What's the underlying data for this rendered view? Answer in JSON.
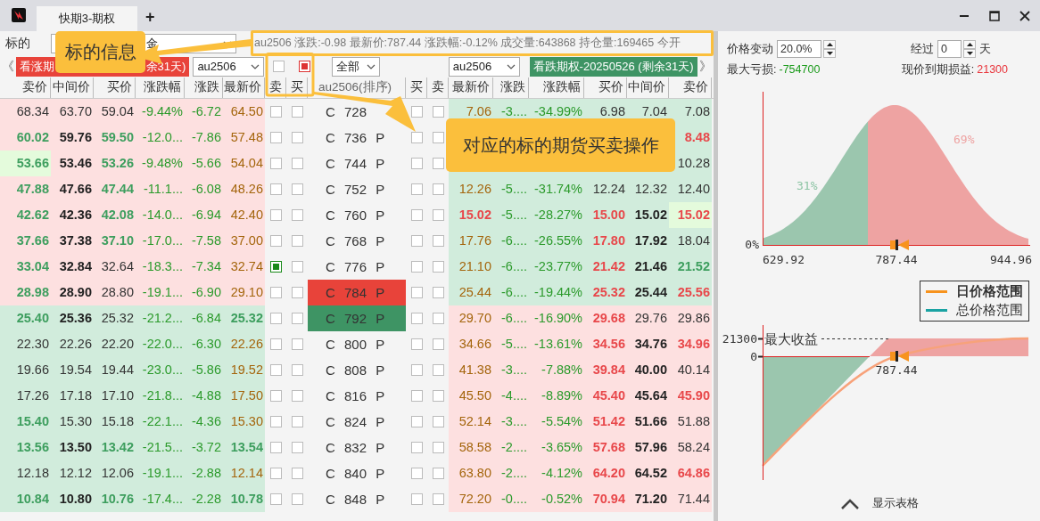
{
  "tab": {
    "label": "快期3-期权",
    "selected": true
  },
  "new_tab": "+",
  "underlying": {
    "label": "标的",
    "value": "金"
  },
  "info": "au2506 涨跌:-0.98 最新价:787.44 涨跌幅:-0.12% 成交量:643868 持仓量:169465 今开",
  "toolbar": {
    "prev": "《",
    "call_banner_parts": [
      "看涨期",
      "余31天)"
    ],
    "call_contract": "au2506",
    "future_checks": [
      {
        "checked": false
      },
      {
        "checked": true
      }
    ],
    "filter": "全部",
    "put_contract": "au2506",
    "put_banner": "看跌期权-20250526 (剩余31天)",
    "next": "》"
  },
  "headers": [
    "卖价",
    "中间价",
    "买价",
    "涨跌幅",
    "涨跌",
    "最新价",
    "卖",
    "买",
    "au2506(排序)",
    "买",
    "卖",
    "最新价",
    "涨跌",
    "涨跌幅",
    "买价",
    "中间价",
    "卖价"
  ],
  "rows": [
    {
      "strike": "C 728",
      "call_itm": true,
      "checks": [
        false,
        false,
        false,
        false
      ],
      "call": {
        "ask": {
          "text": "68.34",
          "kind": "plain"
        },
        "mid": {
          "text": "63.70",
          "kind": "plain"
        },
        "bid": {
          "text": "59.04",
          "kind": "plain"
        },
        "change_pct": {
          "text": "-9.44%",
          "kind": "chg"
        },
        "change": {
          "text": "-6.72",
          "kind": "chg"
        },
        "last": {
          "text": "64.50",
          "kind": "last"
        }
      },
      "put": {
        "last": {
          "text": "7.06",
          "kind": "last"
        },
        "change": {
          "text": "-3....",
          "kind": "chg"
        },
        "change_pct": {
          "text": "-34.99%",
          "kind": "chg"
        },
        "bid": {
          "text": "6.98",
          "kind": "plain"
        },
        "mid": {
          "text": "7.04",
          "kind": "plain"
        },
        "ask": {
          "text": "7.08",
          "kind": "plain"
        }
      }
    },
    {
      "strike": "C 736 P",
      "call_itm": true,
      "checks": [
        false,
        false,
        false,
        false
      ],
      "call": {
        "ask": {
          "text": "60.02",
          "kind": "down"
        },
        "mid": {
          "text": "59.76",
          "kind": "bold"
        },
        "bid": {
          "text": "59.50",
          "kind": "down"
        },
        "change_pct": {
          "text": "-12.0...",
          "kind": "chg"
        },
        "change": {
          "text": "-7.86",
          "kind": "chg"
        },
        "last": {
          "text": "57.48",
          "kind": "last"
        }
      },
      "put": {
        "ask": {
          "text": "8.48",
          "kind": "up"
        }
      }
    },
    {
      "strike": "C 744 P",
      "call_itm": true,
      "checks": [
        false,
        false,
        false,
        false
      ],
      "call": {
        "ask": {
          "text": "53.66",
          "kind": "down",
          "highlight": true
        },
        "mid": {
          "text": "53.46",
          "kind": "bold"
        },
        "bid": {
          "text": "53.26",
          "kind": "down"
        },
        "change_pct": {
          "text": "-9.48%",
          "kind": "chg"
        },
        "change": {
          "text": "-5.66",
          "kind": "chg"
        },
        "last": {
          "text": "54.04",
          "kind": "last"
        }
      },
      "put": {
        "ask": {
          "text": "10.28",
          "kind": "plain"
        }
      }
    },
    {
      "strike": "C 752 P",
      "call_itm": true,
      "checks": [
        false,
        false,
        false,
        false
      ],
      "call": {
        "ask": {
          "text": "47.88",
          "kind": "down"
        },
        "mid": {
          "text": "47.66",
          "kind": "bold"
        },
        "bid": {
          "text": "47.44",
          "kind": "down"
        },
        "change_pct": {
          "text": "-11.1...",
          "kind": "chg"
        },
        "change": {
          "text": "-6.08",
          "kind": "chg"
        },
        "last": {
          "text": "48.26",
          "kind": "last"
        }
      },
      "put": {
        "last": {
          "text": "12.26",
          "kind": "last"
        },
        "change": {
          "text": "-5....",
          "kind": "chg"
        },
        "change_pct": {
          "text": "-31.74%",
          "kind": "chg"
        },
        "bid": {
          "text": "12.24",
          "kind": "plain"
        },
        "mid": {
          "text": "12.32",
          "kind": "plain"
        },
        "ask": {
          "text": "12.40",
          "kind": "plain"
        }
      }
    },
    {
      "strike": "C 760 P",
      "call_itm": true,
      "checks": [
        false,
        false,
        false,
        false
      ],
      "call": {
        "ask": {
          "text": "42.62",
          "kind": "down"
        },
        "mid": {
          "text": "42.36",
          "kind": "bold"
        },
        "bid": {
          "text": "42.08",
          "kind": "down"
        },
        "change_pct": {
          "text": "-14.0...",
          "kind": "chg"
        },
        "change": {
          "text": "-6.94",
          "kind": "chg"
        },
        "last": {
          "text": "42.40",
          "kind": "last"
        }
      },
      "put": {
        "last": {
          "text": "15.02",
          "kind": "up"
        },
        "change": {
          "text": "-5....",
          "kind": "chg"
        },
        "change_pct": {
          "text": "-28.27%",
          "kind": "chg"
        },
        "bid": {
          "text": "15.00",
          "kind": "up"
        },
        "mid": {
          "text": "15.02",
          "kind": "bold"
        },
        "ask": {
          "text": "15.02",
          "kind": "up",
          "highlight": true
        }
      }
    },
    {
      "strike": "C 768 P",
      "call_itm": true,
      "checks": [
        false,
        false,
        false,
        false
      ],
      "call": {
        "ask": {
          "text": "37.66",
          "kind": "down"
        },
        "mid": {
          "text": "37.38",
          "kind": "bold"
        },
        "bid": {
          "text": "37.10",
          "kind": "down"
        },
        "change_pct": {
          "text": "-17.0...",
          "kind": "chg"
        },
        "change": {
          "text": "-7.58",
          "kind": "chg"
        },
        "last": {
          "text": "37.00",
          "kind": "last"
        }
      },
      "put": {
        "last": {
          "text": "17.76",
          "kind": "last"
        },
        "change": {
          "text": "-6....",
          "kind": "chg"
        },
        "change_pct": {
          "text": "-26.55%",
          "kind": "chg"
        },
        "bid": {
          "text": "17.80",
          "kind": "up"
        },
        "mid": {
          "text": "17.92",
          "kind": "bold"
        },
        "ask": {
          "text": "18.04",
          "kind": "plain"
        }
      }
    },
    {
      "strike": "C 776 P",
      "call_itm": true,
      "checks": [
        true,
        false,
        false,
        false
      ],
      "call": {
        "ask": {
          "text": "33.04",
          "kind": "down"
        },
        "mid": {
          "text": "32.84",
          "kind": "bold"
        },
        "bid": {
          "text": "32.64",
          "kind": "plain"
        },
        "change_pct": {
          "text": "-18.3...",
          "kind": "chg"
        },
        "change": {
          "text": "-7.34",
          "kind": "chg"
        },
        "last": {
          "text": "32.74",
          "kind": "last"
        }
      },
      "put": {
        "last": {
          "text": "21.10",
          "kind": "last"
        },
        "change": {
          "text": "-6....",
          "kind": "chg"
        },
        "change_pct": {
          "text": "-23.77%",
          "kind": "chg"
        },
        "bid": {
          "text": "21.42",
          "kind": "up"
        },
        "mid": {
          "text": "21.46",
          "kind": "bold"
        },
        "ask": {
          "text": "21.52",
          "kind": "down"
        }
      }
    },
    {
      "strike": "C 784 P",
      "call_itm": true,
      "color": "#e8433a",
      "checks": [
        false,
        false,
        false,
        false
      ],
      "call": {
        "ask": {
          "text": "28.98",
          "kind": "down"
        },
        "mid": {
          "text": "28.90",
          "kind": "bold"
        },
        "bid": {
          "text": "28.80",
          "kind": "plain"
        },
        "change_pct": {
          "text": "-19.1...",
          "kind": "chg"
        },
        "change": {
          "text": "-6.90",
          "kind": "chg"
        },
        "last": {
          "text": "29.10",
          "kind": "last"
        }
      },
      "put": {
        "last": {
          "text": "25.44",
          "kind": "last"
        },
        "change": {
          "text": "-6....",
          "kind": "chg"
        },
        "change_pct": {
          "text": "-19.44%",
          "kind": "chg"
        },
        "bid": {
          "text": "25.32",
          "kind": "up"
        },
        "mid": {
          "text": "25.44",
          "kind": "bold"
        },
        "ask": {
          "text": "25.56",
          "kind": "up"
        }
      }
    },
    {
      "strike": "C 792 P",
      "call_itm": false,
      "color": "#3e9464",
      "checks": [
        false,
        false,
        false,
        false
      ],
      "call": {
        "ask": {
          "text": "25.40",
          "kind": "down"
        },
        "mid": {
          "text": "25.36",
          "kind": "bold"
        },
        "bid": {
          "text": "25.32",
          "kind": "plain"
        },
        "change_pct": {
          "text": "-21.2...",
          "kind": "chg"
        },
        "change": {
          "text": "-6.84",
          "kind": "chg"
        },
        "last": {
          "text": "25.32",
          "kind": "down"
        }
      },
      "put": {
        "last": {
          "text": "29.70",
          "kind": "last"
        },
        "change": {
          "text": "-6....",
          "kind": "chg"
        },
        "change_pct": {
          "text": "-16.90%",
          "kind": "chg"
        },
        "bid": {
          "text": "29.68",
          "kind": "up"
        },
        "mid": {
          "text": "29.76",
          "kind": "plain"
        },
        "ask": {
          "text": "29.86",
          "kind": "plain"
        }
      }
    },
    {
      "strike": "C 800 P",
      "call_itm": false,
      "checks": [
        false,
        false,
        false,
        false
      ],
      "call": {
        "ask": {
          "text": "22.30",
          "kind": "plain"
        },
        "mid": {
          "text": "22.26",
          "kind": "plain"
        },
        "bid": {
          "text": "22.20",
          "kind": "plain"
        },
        "change_pct": {
          "text": "-22.0...",
          "kind": "chg"
        },
        "change": {
          "text": "-6.30",
          "kind": "chg"
        },
        "last": {
          "text": "22.26",
          "kind": "last"
        }
      },
      "put": {
        "last": {
          "text": "34.66",
          "kind": "last"
        },
        "change": {
          "text": "-5....",
          "kind": "chg"
        },
        "change_pct": {
          "text": "-13.61%",
          "kind": "chg"
        },
        "bid": {
          "text": "34.56",
          "kind": "up"
        },
        "mid": {
          "text": "34.76",
          "kind": "bold"
        },
        "ask": {
          "text": "34.96",
          "kind": "up"
        }
      }
    },
    {
      "strike": "C 808 P",
      "call_itm": false,
      "checks": [
        false,
        false,
        false,
        false
      ],
      "call": {
        "ask": {
          "text": "19.66",
          "kind": "plain"
        },
        "mid": {
          "text": "19.54",
          "kind": "plain"
        },
        "bid": {
          "text": "19.44",
          "kind": "plain"
        },
        "change_pct": {
          "text": "-23.0...",
          "kind": "chg"
        },
        "change": {
          "text": "-5.86",
          "kind": "chg"
        },
        "last": {
          "text": "19.52",
          "kind": "last"
        }
      },
      "put": {
        "last": {
          "text": "41.38",
          "kind": "last"
        },
        "change": {
          "text": "-3....",
          "kind": "chg"
        },
        "change_pct": {
          "text": "-7.88%",
          "kind": "chg"
        },
        "bid": {
          "text": "39.84",
          "kind": "up"
        },
        "mid": {
          "text": "40.00",
          "kind": "bold"
        },
        "ask": {
          "text": "40.14",
          "kind": "plain"
        }
      }
    },
    {
      "strike": "C 816 P",
      "call_itm": false,
      "checks": [
        false,
        false,
        false,
        false
      ],
      "call": {
        "ask": {
          "text": "17.26",
          "kind": "plain"
        },
        "mid": {
          "text": "17.18",
          "kind": "plain"
        },
        "bid": {
          "text": "17.10",
          "kind": "plain"
        },
        "change_pct": {
          "text": "-21.8...",
          "kind": "chg"
        },
        "change": {
          "text": "-4.88",
          "kind": "chg"
        },
        "last": {
          "text": "17.50",
          "kind": "last"
        }
      },
      "put": {
        "last": {
          "text": "45.50",
          "kind": "last"
        },
        "change": {
          "text": "-4....",
          "kind": "chg"
        },
        "change_pct": {
          "text": "-8.89%",
          "kind": "chg"
        },
        "bid": {
          "text": "45.40",
          "kind": "up"
        },
        "mid": {
          "text": "45.64",
          "kind": "bold"
        },
        "ask": {
          "text": "45.90",
          "kind": "up"
        }
      }
    },
    {
      "strike": "C 824 P",
      "call_itm": false,
      "checks": [
        false,
        false,
        false,
        false
      ],
      "call": {
        "ask": {
          "text": "15.40",
          "kind": "down"
        },
        "mid": {
          "text": "15.30",
          "kind": "plain"
        },
        "bid": {
          "text": "15.18",
          "kind": "plain"
        },
        "change_pct": {
          "text": "-22.1...",
          "kind": "chg"
        },
        "change": {
          "text": "-4.36",
          "kind": "chg"
        },
        "last": {
          "text": "15.30",
          "kind": "last"
        }
      },
      "put": {
        "last": {
          "text": "52.14",
          "kind": "last"
        },
        "change": {
          "text": "-3....",
          "kind": "chg"
        },
        "change_pct": {
          "text": "-5.54%",
          "kind": "chg"
        },
        "bid": {
          "text": "51.42",
          "kind": "up"
        },
        "mid": {
          "text": "51.66",
          "kind": "bold"
        },
        "ask": {
          "text": "51.88",
          "kind": "plain"
        }
      }
    },
    {
      "strike": "C 832 P",
      "call_itm": false,
      "checks": [
        false,
        false,
        false,
        false
      ],
      "call": {
        "ask": {
          "text": "13.56",
          "kind": "down"
        },
        "mid": {
          "text": "13.50",
          "kind": "bold"
        },
        "bid": {
          "text": "13.42",
          "kind": "down"
        },
        "change_pct": {
          "text": "-21.5...",
          "kind": "chg"
        },
        "change": {
          "text": "-3.72",
          "kind": "chg"
        },
        "last": {
          "text": "13.54",
          "kind": "down"
        }
      },
      "put": {
        "last": {
          "text": "58.58",
          "kind": "last"
        },
        "change": {
          "text": "-2....",
          "kind": "chg"
        },
        "change_pct": {
          "text": "-3.65%",
          "kind": "chg"
        },
        "bid": {
          "text": "57.68",
          "kind": "up"
        },
        "mid": {
          "text": "57.96",
          "kind": "bold"
        },
        "ask": {
          "text": "58.24",
          "kind": "plain"
        }
      }
    },
    {
      "strike": "C 840 P",
      "call_itm": false,
      "checks": [
        false,
        false,
        false,
        false
      ],
      "call": {
        "ask": {
          "text": "12.18",
          "kind": "plain"
        },
        "mid": {
          "text": "12.12",
          "kind": "plain"
        },
        "bid": {
          "text": "12.06",
          "kind": "plain"
        },
        "change_pct": {
          "text": "-19.1...",
          "kind": "chg"
        },
        "change": {
          "text": "-2.88",
          "kind": "chg"
        },
        "last": {
          "text": "12.14",
          "kind": "last"
        }
      },
      "put": {
        "last": {
          "text": "63.80",
          "kind": "last"
        },
        "change": {
          "text": "-2....",
          "kind": "chg"
        },
        "change_pct": {
          "text": "-4.12%",
          "kind": "chg"
        },
        "bid": {
          "text": "64.20",
          "kind": "up"
        },
        "mid": {
          "text": "64.52",
          "kind": "bold"
        },
        "ask": {
          "text": "64.86",
          "kind": "up"
        }
      }
    },
    {
      "strike": "C 848 P",
      "call_itm": false,
      "checks": [
        false,
        false,
        false,
        false
      ],
      "call": {
        "ask": {
          "text": "10.84",
          "kind": "down"
        },
        "mid": {
          "text": "10.80",
          "kind": "bold"
        },
        "bid": {
          "text": "10.76",
          "kind": "down"
        },
        "change_pct": {
          "text": "-17.4...",
          "kind": "chg"
        },
        "change": {
          "text": "-2.28",
          "kind": "chg"
        },
        "last": {
          "text": "10.78",
          "kind": "down"
        }
      },
      "put": {
        "last": {
          "text": "72.20",
          "kind": "last"
        },
        "change": {
          "text": "-0....",
          "kind": "chg"
        },
        "change_pct": {
          "text": "-0.52%",
          "kind": "chg"
        },
        "bid": {
          "text": "70.94",
          "kind": "up"
        },
        "mid": {
          "text": "71.20",
          "kind": "bold"
        },
        "ask": {
          "text": "71.44",
          "kind": "plain"
        }
      }
    }
  ],
  "analysis": {
    "price_change": {
      "label": "价格变动",
      "value": "20.0%"
    },
    "elapsed": {
      "label": "经过",
      "value": "0",
      "unit": "天"
    },
    "max_loss": {
      "label": "最大亏损:",
      "value": "-754700"
    },
    "expiry_pnl": {
      "label": "现价到期损益:",
      "value": "21300"
    },
    "distribution": {
      "y_label": "0%",
      "left_share": "31%",
      "right_share": "69%",
      "x_labels": [
        "629.92",
        "787.44",
        "944.96"
      ]
    },
    "legend": [
      {
        "label": "日价格范围",
        "color": "#f7931e",
        "selected": true
      },
      {
        "label": "总价格范围",
        "color": "#1aa3a3",
        "selected": false
      }
    ],
    "payoff": {
      "max_value": "21300",
      "max_label": "最大收益",
      "zero": "0",
      "price": "787.44"
    },
    "toggle": "显示表格"
  },
  "annotations": [
    {
      "text": "标的信息"
    },
    {
      "text": "对应的标的期货买卖操作"
    }
  ]
}
